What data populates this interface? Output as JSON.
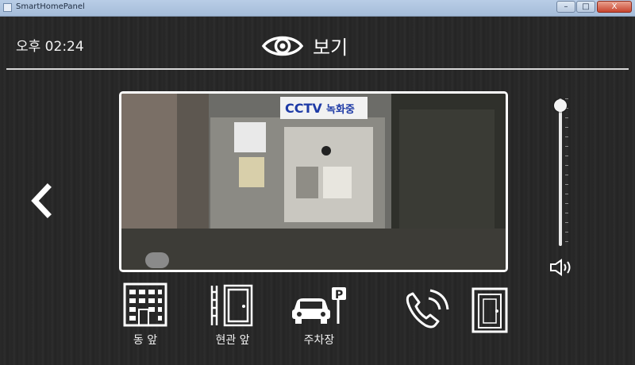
{
  "window": {
    "title": "SmartHomePanel",
    "faded_title": "",
    "controls": {
      "minimize": "–",
      "maximize": "□",
      "close": "X"
    }
  },
  "header": {
    "time": "오후 02:24",
    "title": "보기"
  },
  "camera": {
    "sign_text_1": "CCTV",
    "sign_text_2": "녹화중"
  },
  "volume": {
    "level": 0.95
  },
  "nav": {
    "front": {
      "label": "동 앞",
      "icon": "building-icon"
    },
    "entrance": {
      "label": "현관 앞",
      "icon": "entrance-door-icon"
    },
    "parking": {
      "label": "주차장",
      "icon": "parking-car-icon"
    }
  },
  "actions": {
    "call_icon": "phone-call-icon",
    "door_icon": "door-open-icon"
  }
}
